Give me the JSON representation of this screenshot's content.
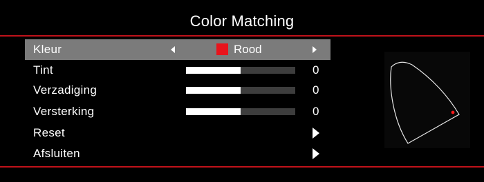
{
  "title": "Color Matching",
  "menu": {
    "kleur": {
      "label": "Kleur",
      "value": "Rood",
      "swatch_color": "#e8141c"
    },
    "tint": {
      "label": "Tint",
      "value": "0",
      "level": 0.5
    },
    "verzadiging": {
      "label": "Verzadiging",
      "value": "0",
      "level": 0.5
    },
    "versterking": {
      "label": "Versterking",
      "value": "0",
      "level": 0.5
    },
    "reset": {
      "label": "Reset"
    },
    "afsluiten": {
      "label": "Afsluiten"
    }
  },
  "colors": {
    "accent": "#c0121a",
    "selected_row": "#7b7b7b",
    "point": "#ff1a1a"
  }
}
